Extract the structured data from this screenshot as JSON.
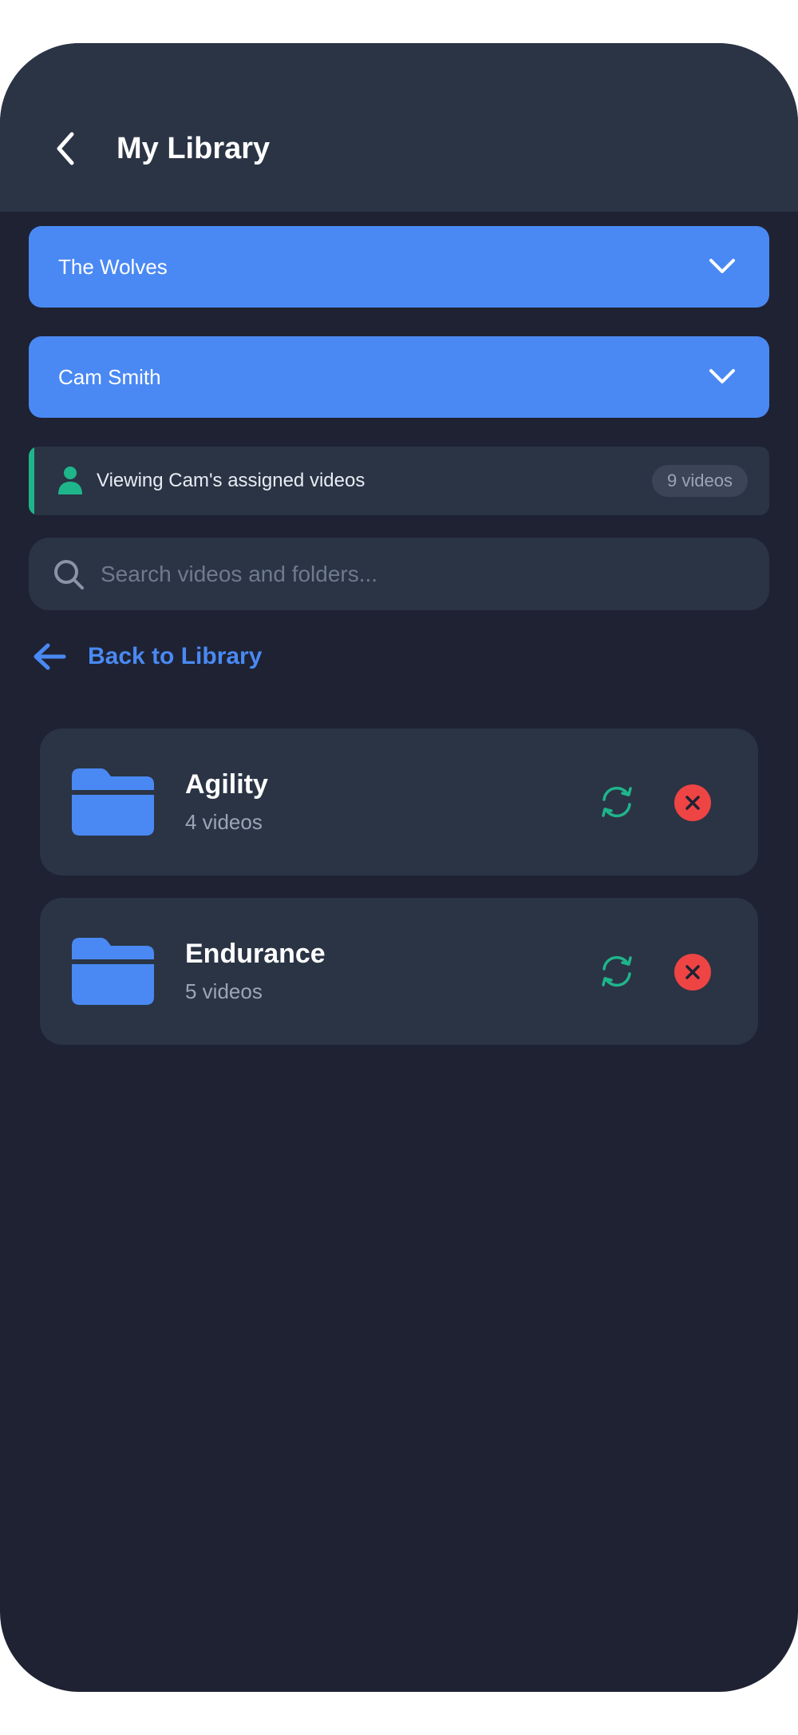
{
  "header": {
    "title": "My Library"
  },
  "team_select": {
    "value": "The Wolves"
  },
  "player_select": {
    "value": "Cam Smith"
  },
  "banner": {
    "text": "Viewing Cam's assigned videos",
    "count": "9 videos"
  },
  "search": {
    "placeholder": "Search videos and folders..."
  },
  "back_link": {
    "label": "Back to Library"
  },
  "folders": [
    {
      "name": "Agility",
      "count": "4 videos"
    },
    {
      "name": "Endurance",
      "count": "5 videos"
    }
  ],
  "colors": {
    "accent": "#4a89f3",
    "success": "#1fb58a",
    "danger": "#ef4444",
    "background": "#1e2233",
    "card": "#2a3445"
  }
}
